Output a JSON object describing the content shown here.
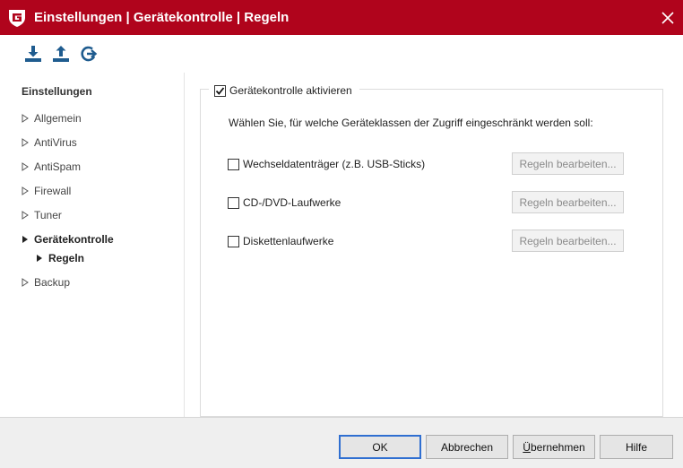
{
  "window": {
    "title": "Einstellungen | Gerätekontrolle | Regeln",
    "brand_color": "#b0041c"
  },
  "toolbar": {
    "buttons": [
      {
        "icon": "import-icon"
      },
      {
        "icon": "export-icon"
      },
      {
        "icon": "reset-icon"
      }
    ]
  },
  "sidebar": {
    "heading": "Einstellungen",
    "items": [
      {
        "label": "Allgemein"
      },
      {
        "label": "AntiVirus"
      },
      {
        "label": "AntiSpam"
      },
      {
        "label": "Firewall"
      },
      {
        "label": "Tuner"
      },
      {
        "label": "Gerätekontrolle"
      },
      {
        "label": "Regeln"
      },
      {
        "label": "Backup"
      }
    ]
  },
  "content": {
    "enable_label": "Gerätekontrolle aktivieren",
    "enable_checked": true,
    "description": "Wählen Sie, für welche Geräteklassen der Zugriff eingeschränkt werden soll:",
    "device_classes": [
      {
        "label": "Wechseldatenträger (z.B. USB-Sticks)",
        "checked": false,
        "button": "Regeln bearbeiten..."
      },
      {
        "label": "CD-/DVD-Laufwerke",
        "checked": false,
        "button": "Regeln bearbeiten..."
      },
      {
        "label": "Diskettenlaufwerke",
        "checked": false,
        "button": "Regeln bearbeiten..."
      }
    ]
  },
  "footer": {
    "ok": "OK",
    "cancel": "Abbrechen",
    "apply_prefix": "",
    "apply_underlined": "Ü",
    "apply_rest": "bernehmen",
    "help": "Hilfe"
  }
}
